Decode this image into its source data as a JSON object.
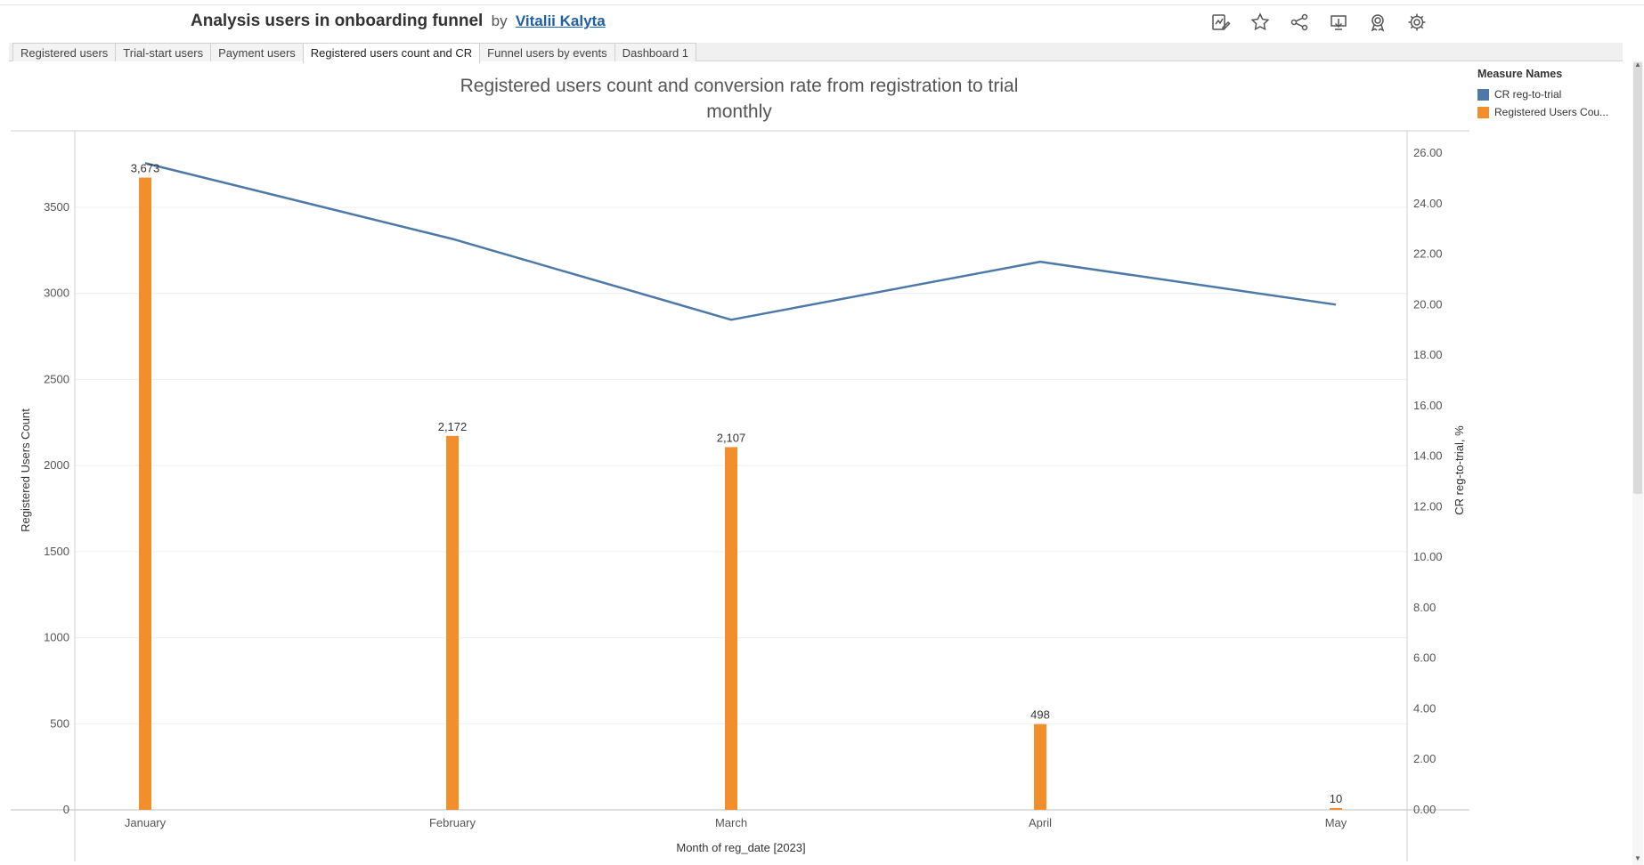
{
  "header": {
    "title": "Analysis users in onboarding funnel",
    "by": "by",
    "author": "Vitalii Kalyta"
  },
  "toolbar": {
    "icons": [
      "edit-icon",
      "star-icon",
      "share-icon",
      "download-icon",
      "badge-icon",
      "gear-icon"
    ]
  },
  "tabs": [
    {
      "label": "Registered users",
      "active": false
    },
    {
      "label": "Trial-start users",
      "active": false
    },
    {
      "label": "Payment users",
      "active": false
    },
    {
      "label": "Registered users count and CR",
      "active": true
    },
    {
      "label": "Funnel users by events",
      "active": false
    },
    {
      "label": "Dashboard 1",
      "active": false
    }
  ],
  "chart": {
    "title_line1": "Registered users count and conversion rate from registration to trial",
    "title_line2": "monthly"
  },
  "legend": {
    "header": "Measure Names",
    "items": [
      {
        "label": "CR reg-to-trial",
        "color": "#4e79a7"
      },
      {
        "label": "Registered Users Cou...",
        "color": "#f28e2b"
      }
    ]
  },
  "chart_data": {
    "type": "bar",
    "categories": [
      "January",
      "February",
      "March",
      "April",
      "May"
    ],
    "xlabel": "Month of reg_date [2023]",
    "ylabel": "Registered Users Count",
    "y2label": "CR reg-to-trial, %",
    "ylim": [
      0,
      3800
    ],
    "y2lim": [
      0,
      26.5
    ],
    "yticks": [
      "0",
      "500",
      "1000",
      "1500",
      "2000",
      "2500",
      "3000",
      "3500"
    ],
    "y2ticks": [
      "0.00",
      "2.00",
      "4.00",
      "6.00",
      "8.00",
      "10.00",
      "12.00",
      "14.00",
      "16.00",
      "18.00",
      "20.00",
      "22.00",
      "24.00",
      "26.00"
    ],
    "grid": true,
    "legend_position": "top-right",
    "series": [
      {
        "name": "Registered Users Count",
        "type": "bar",
        "axis": "left",
        "color": "#f28e2b",
        "values": [
          3673,
          2172,
          2107,
          498,
          10
        ],
        "labels": [
          "3,673",
          "2,172",
          "2,107",
          "498",
          "10"
        ]
      },
      {
        "name": "CR reg-to-trial",
        "type": "line",
        "axis": "right",
        "color": "#4e79a7",
        "values": [
          25.6,
          22.6,
          19.4,
          21.7,
          20.0
        ]
      }
    ]
  }
}
